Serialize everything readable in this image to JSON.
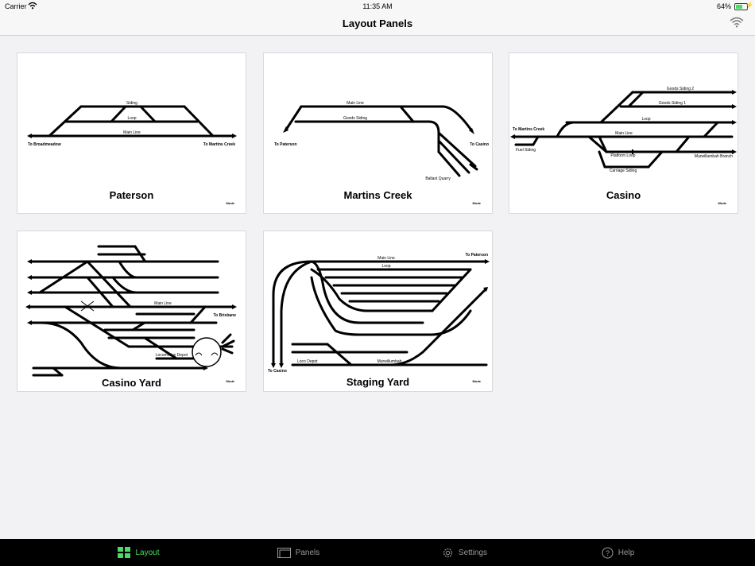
{
  "status_bar": {
    "carrier": "Carrier",
    "time": "11:35 AM",
    "battery": "64%",
    "wifi_icon": "wifi-icon",
    "battery_icon": "battery-icon"
  },
  "nav": {
    "title": "Layout Panels",
    "wifi_button_icon": "wifi-icon"
  },
  "panels": [
    {
      "name": "Paterson",
      "mode": "Mode",
      "labels": [
        "Siding",
        "Loop",
        "Main Line",
        "To Broadmeadow",
        "To Martins Creek"
      ]
    },
    {
      "name": "Martins Creek",
      "mode": "Mode",
      "labels": [
        "Main Line",
        "Goods Siding",
        "To Paterson",
        "To Casino",
        "Ballast Quarry"
      ]
    },
    {
      "name": "Casino",
      "mode": "Mode",
      "labels": [
        "Goods Siding 2",
        "Goods Siding 1",
        "Loop",
        "To Martins Creek",
        "Main Line",
        "Fuel Siding",
        "Platform Loop",
        "Murwillumbah Branch",
        "Carriage Siding"
      ]
    },
    {
      "name": "Casino Yard",
      "mode": "Mode",
      "labels": [
        "Main Line",
        "To Brisbane",
        "Locomotive Depot"
      ]
    },
    {
      "name": "Staging Yard",
      "mode": "Mode",
      "labels": [
        "Main Line",
        "To Paterson",
        "Loop",
        "To Casino",
        "Loco Depot",
        "Murwillumbah"
      ]
    }
  ],
  "tabs": [
    {
      "label": "Layout",
      "icon": "grid-icon",
      "active": true
    },
    {
      "label": "Panels",
      "icon": "panels-icon",
      "active": false
    },
    {
      "label": "Settings",
      "icon": "gear-icon",
      "active": false
    },
    {
      "label": "Help",
      "icon": "help-icon",
      "active": false
    }
  ],
  "colors": {
    "accent": "#4cd964",
    "tab_inactive": "#9a9a9a",
    "tab_bar": "#000000",
    "background": "#f2f2f4"
  }
}
